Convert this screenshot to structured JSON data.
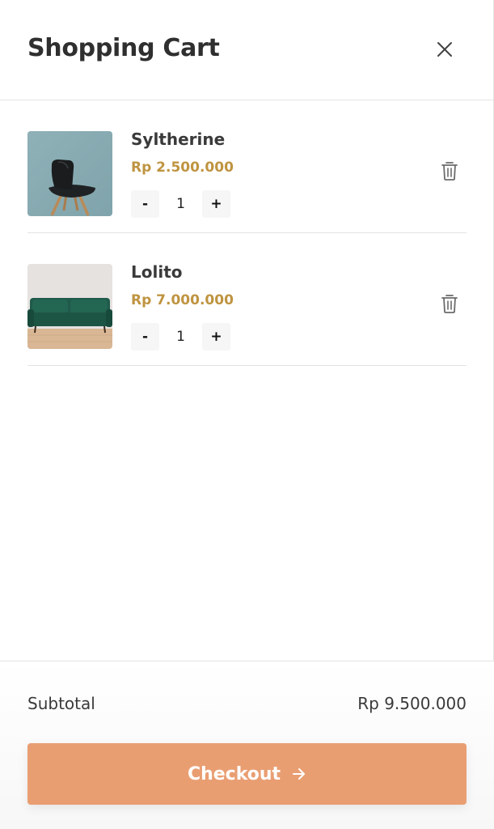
{
  "header": {
    "title": "Shopping Cart",
    "close_icon": "close-icon"
  },
  "cart": {
    "items": [
      {
        "name": "Syltherine",
        "price": "Rp 2.500.000",
        "quantity": "1",
        "decrement_label": "-",
        "increment_label": "+",
        "image": "chair-image",
        "delete_icon": "trash-icon"
      },
      {
        "name": "Lolito",
        "price": "Rp 7.000.000",
        "quantity": "1",
        "decrement_label": "-",
        "increment_label": "+",
        "image": "sofa-image",
        "delete_icon": "trash-icon"
      }
    ]
  },
  "footer": {
    "subtotal_label": "Subtotal",
    "subtotal_value": "Rp 9.500.000",
    "checkout_label": "Checkout",
    "checkout_icon": "arrow-right-icon"
  },
  "colors": {
    "price": "#bf9440",
    "checkout_bg": "#e99e72",
    "text": "#2f2f2f"
  }
}
